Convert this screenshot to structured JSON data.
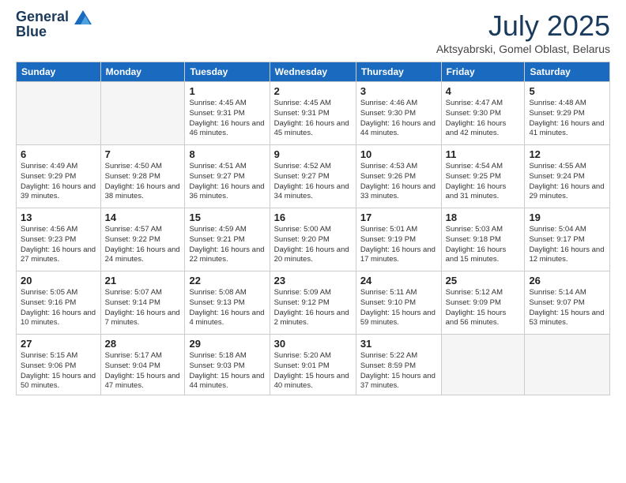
{
  "header": {
    "logo_line1": "General",
    "logo_line2": "Blue",
    "title": "July 2025",
    "subtitle": "Aktsyabrski, Gomel Oblast, Belarus"
  },
  "days_of_week": [
    "Sunday",
    "Monday",
    "Tuesday",
    "Wednesday",
    "Thursday",
    "Friday",
    "Saturday"
  ],
  "weeks": [
    [
      {
        "day": "",
        "sunrise": "",
        "sunset": "",
        "daylight": ""
      },
      {
        "day": "",
        "sunrise": "",
        "sunset": "",
        "daylight": ""
      },
      {
        "day": "1",
        "sunrise": "Sunrise: 4:45 AM",
        "sunset": "Sunset: 9:31 PM",
        "daylight": "Daylight: 16 hours and 46 minutes."
      },
      {
        "day": "2",
        "sunrise": "Sunrise: 4:45 AM",
        "sunset": "Sunset: 9:31 PM",
        "daylight": "Daylight: 16 hours and 45 minutes."
      },
      {
        "day": "3",
        "sunrise": "Sunrise: 4:46 AM",
        "sunset": "Sunset: 9:30 PM",
        "daylight": "Daylight: 16 hours and 44 minutes."
      },
      {
        "day": "4",
        "sunrise": "Sunrise: 4:47 AM",
        "sunset": "Sunset: 9:30 PM",
        "daylight": "Daylight: 16 hours and 42 minutes."
      },
      {
        "day": "5",
        "sunrise": "Sunrise: 4:48 AM",
        "sunset": "Sunset: 9:29 PM",
        "daylight": "Daylight: 16 hours and 41 minutes."
      }
    ],
    [
      {
        "day": "6",
        "sunrise": "Sunrise: 4:49 AM",
        "sunset": "Sunset: 9:29 PM",
        "daylight": "Daylight: 16 hours and 39 minutes."
      },
      {
        "day": "7",
        "sunrise": "Sunrise: 4:50 AM",
        "sunset": "Sunset: 9:28 PM",
        "daylight": "Daylight: 16 hours and 38 minutes."
      },
      {
        "day": "8",
        "sunrise": "Sunrise: 4:51 AM",
        "sunset": "Sunset: 9:27 PM",
        "daylight": "Daylight: 16 hours and 36 minutes."
      },
      {
        "day": "9",
        "sunrise": "Sunrise: 4:52 AM",
        "sunset": "Sunset: 9:27 PM",
        "daylight": "Daylight: 16 hours and 34 minutes."
      },
      {
        "day": "10",
        "sunrise": "Sunrise: 4:53 AM",
        "sunset": "Sunset: 9:26 PM",
        "daylight": "Daylight: 16 hours and 33 minutes."
      },
      {
        "day": "11",
        "sunrise": "Sunrise: 4:54 AM",
        "sunset": "Sunset: 9:25 PM",
        "daylight": "Daylight: 16 hours and 31 minutes."
      },
      {
        "day": "12",
        "sunrise": "Sunrise: 4:55 AM",
        "sunset": "Sunset: 9:24 PM",
        "daylight": "Daylight: 16 hours and 29 minutes."
      }
    ],
    [
      {
        "day": "13",
        "sunrise": "Sunrise: 4:56 AM",
        "sunset": "Sunset: 9:23 PM",
        "daylight": "Daylight: 16 hours and 27 minutes."
      },
      {
        "day": "14",
        "sunrise": "Sunrise: 4:57 AM",
        "sunset": "Sunset: 9:22 PM",
        "daylight": "Daylight: 16 hours and 24 minutes."
      },
      {
        "day": "15",
        "sunrise": "Sunrise: 4:59 AM",
        "sunset": "Sunset: 9:21 PM",
        "daylight": "Daylight: 16 hours and 22 minutes."
      },
      {
        "day": "16",
        "sunrise": "Sunrise: 5:00 AM",
        "sunset": "Sunset: 9:20 PM",
        "daylight": "Daylight: 16 hours and 20 minutes."
      },
      {
        "day": "17",
        "sunrise": "Sunrise: 5:01 AM",
        "sunset": "Sunset: 9:19 PM",
        "daylight": "Daylight: 16 hours and 17 minutes."
      },
      {
        "day": "18",
        "sunrise": "Sunrise: 5:03 AM",
        "sunset": "Sunset: 9:18 PM",
        "daylight": "Daylight: 16 hours and 15 minutes."
      },
      {
        "day": "19",
        "sunrise": "Sunrise: 5:04 AM",
        "sunset": "Sunset: 9:17 PM",
        "daylight": "Daylight: 16 hours and 12 minutes."
      }
    ],
    [
      {
        "day": "20",
        "sunrise": "Sunrise: 5:05 AM",
        "sunset": "Sunset: 9:16 PM",
        "daylight": "Daylight: 16 hours and 10 minutes."
      },
      {
        "day": "21",
        "sunrise": "Sunrise: 5:07 AM",
        "sunset": "Sunset: 9:14 PM",
        "daylight": "Daylight: 16 hours and 7 minutes."
      },
      {
        "day": "22",
        "sunrise": "Sunrise: 5:08 AM",
        "sunset": "Sunset: 9:13 PM",
        "daylight": "Daylight: 16 hours and 4 minutes."
      },
      {
        "day": "23",
        "sunrise": "Sunrise: 5:09 AM",
        "sunset": "Sunset: 9:12 PM",
        "daylight": "Daylight: 16 hours and 2 minutes."
      },
      {
        "day": "24",
        "sunrise": "Sunrise: 5:11 AM",
        "sunset": "Sunset: 9:10 PM",
        "daylight": "Daylight: 15 hours and 59 minutes."
      },
      {
        "day": "25",
        "sunrise": "Sunrise: 5:12 AM",
        "sunset": "Sunset: 9:09 PM",
        "daylight": "Daylight: 15 hours and 56 minutes."
      },
      {
        "day": "26",
        "sunrise": "Sunrise: 5:14 AM",
        "sunset": "Sunset: 9:07 PM",
        "daylight": "Daylight: 15 hours and 53 minutes."
      }
    ],
    [
      {
        "day": "27",
        "sunrise": "Sunrise: 5:15 AM",
        "sunset": "Sunset: 9:06 PM",
        "daylight": "Daylight: 15 hours and 50 minutes."
      },
      {
        "day": "28",
        "sunrise": "Sunrise: 5:17 AM",
        "sunset": "Sunset: 9:04 PM",
        "daylight": "Daylight: 15 hours and 47 minutes."
      },
      {
        "day": "29",
        "sunrise": "Sunrise: 5:18 AM",
        "sunset": "Sunset: 9:03 PM",
        "daylight": "Daylight: 15 hours and 44 minutes."
      },
      {
        "day": "30",
        "sunrise": "Sunrise: 5:20 AM",
        "sunset": "Sunset: 9:01 PM",
        "daylight": "Daylight: 15 hours and 40 minutes."
      },
      {
        "day": "31",
        "sunrise": "Sunrise: 5:22 AM",
        "sunset": "Sunset: 8:59 PM",
        "daylight": "Daylight: 15 hours and 37 minutes."
      },
      {
        "day": "",
        "sunrise": "",
        "sunset": "",
        "daylight": ""
      },
      {
        "day": "",
        "sunrise": "",
        "sunset": "",
        "daylight": ""
      }
    ]
  ]
}
